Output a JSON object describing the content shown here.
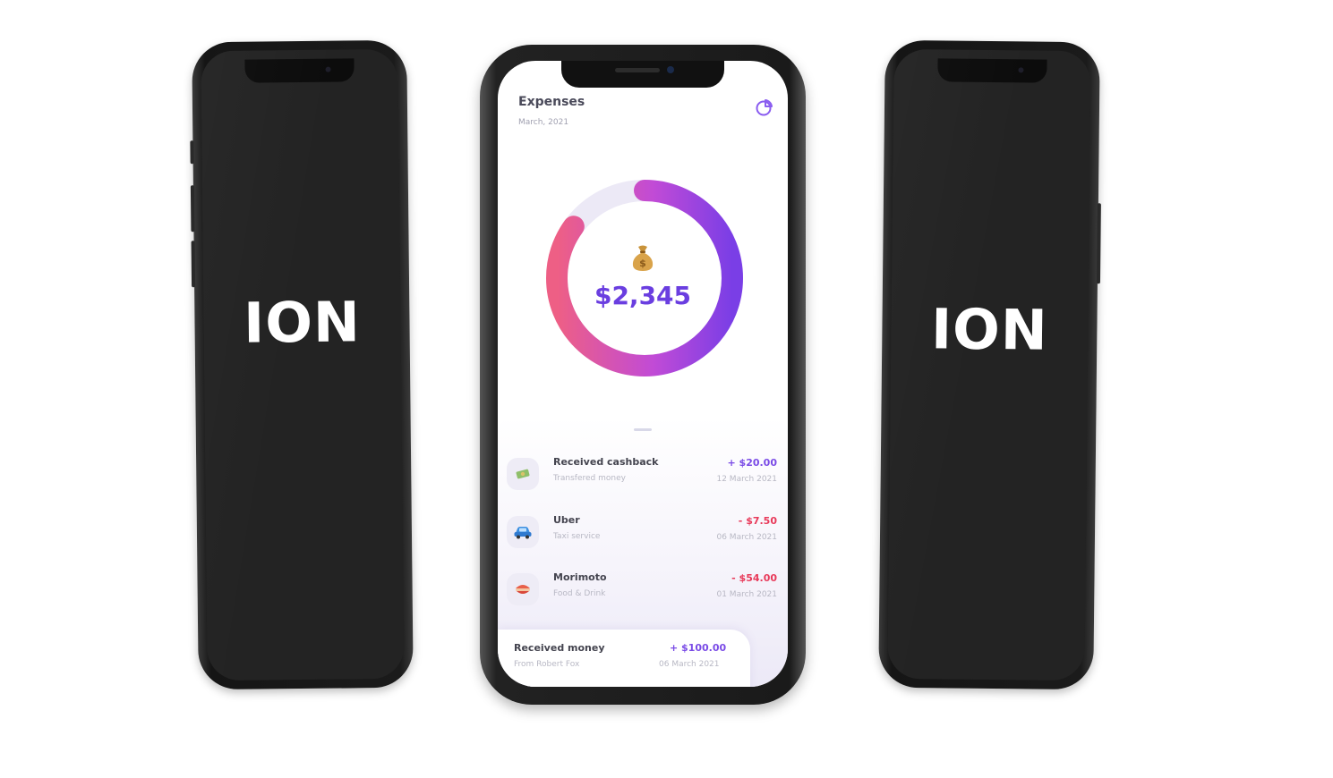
{
  "brand": {
    "left_text": "ION",
    "right_text": "ION"
  },
  "app": {
    "title": "Expenses",
    "period": "March, 2021",
    "total": "$2,345",
    "donut_fill_fraction": 0.85,
    "colors": {
      "accent_purple": "#7a4be6",
      "accent_pink": "#ee5f85",
      "negative": "#e83a5a",
      "track": "#ece9f6"
    }
  },
  "transactions": [
    {
      "icon": "cashback-icon",
      "title": "Received cashback",
      "subtitle": "Transfered money",
      "amount": "+ $20.00",
      "date": "12 March 2021",
      "sign": "plus"
    },
    {
      "icon": "car-icon",
      "title": "Uber",
      "subtitle": "Taxi service",
      "amount": "- $7.50",
      "date": "06 March 2021",
      "sign": "minus"
    },
    {
      "icon": "food-icon",
      "title": "Morimoto",
      "subtitle": "Food & Drink",
      "amount": "- $54.00",
      "date": "01 March 2021",
      "sign": "minus"
    }
  ],
  "bottom_card": {
    "title": "Received money",
    "subtitle": "From Robert Fox",
    "amount": "+ $100.00",
    "date": "06 March 2021"
  }
}
